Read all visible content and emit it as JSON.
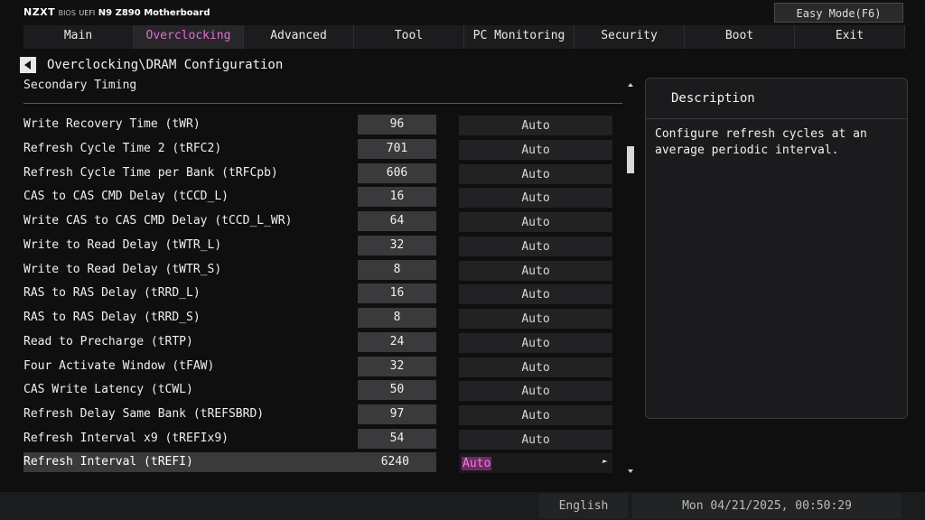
{
  "header": {
    "brand": "NZXT",
    "bios": "BIOS",
    "uefi": "UEFI",
    "model": "N9 Z890 Motherboard",
    "easy_mode_label": "Easy Mode(F6)"
  },
  "tabs": [
    {
      "label": "Main"
    },
    {
      "label": "Overclocking",
      "active": true
    },
    {
      "label": "Advanced"
    },
    {
      "label": "Tool"
    },
    {
      "label": "PC Monitoring"
    },
    {
      "label": "Security"
    },
    {
      "label": "Boot"
    },
    {
      "label": "Exit"
    }
  ],
  "breadcrumb": "Overclocking\\DRAM Configuration",
  "section_title": "Secondary Timing",
  "rows": [
    {
      "label": "Write Recovery Time (tWR)",
      "value": "96",
      "mode": "Auto"
    },
    {
      "label": "Refresh Cycle Time 2 (tRFC2)",
      "value": "701",
      "mode": "Auto"
    },
    {
      "label": "Refresh Cycle Time per Bank (tRFCpb)",
      "value": "606",
      "mode": "Auto"
    },
    {
      "label": "CAS to CAS CMD Delay (tCCD_L)",
      "value": "16",
      "mode": "Auto"
    },
    {
      "label": "Write CAS to CAS CMD Delay (tCCD_L_WR)",
      "value": "64",
      "mode": "Auto"
    },
    {
      "label": "Write to Read Delay (tWTR_L)",
      "value": "32",
      "mode": "Auto"
    },
    {
      "label": "Write to Read Delay (tWTR_S)",
      "value": "8",
      "mode": "Auto"
    },
    {
      "label": "RAS to RAS Delay (tRRD_L)",
      "value": "16",
      "mode": "Auto"
    },
    {
      "label": "RAS to RAS Delay (tRRD_S)",
      "value": "8",
      "mode": "Auto"
    },
    {
      "label": "Read to Precharge (tRTP)",
      "value": "24",
      "mode": "Auto"
    },
    {
      "label": "Four Activate Window (tFAW)",
      "value": "32",
      "mode": "Auto"
    },
    {
      "label": "CAS Write Latency (tCWL)",
      "value": "50",
      "mode": "Auto"
    },
    {
      "label": "Refresh Delay Same Bank (tREFSBRD)",
      "value": "97",
      "mode": "Auto"
    },
    {
      "label": "Refresh Interval x9 (tREFIx9)",
      "value": "54",
      "mode": "Auto"
    },
    {
      "label": "Refresh Interval (tREFI)",
      "value": "6240",
      "mode": "Auto",
      "selected": true
    }
  ],
  "description": {
    "title": "Description",
    "text": "Configure refresh cycles at an average periodic interval."
  },
  "footer": {
    "language": "English",
    "datetime": "Mon 04/21/2025, 00:50:29"
  },
  "colors": {
    "accent": "#e06cd0",
    "selected_mode_bg": "#6d2a63"
  }
}
